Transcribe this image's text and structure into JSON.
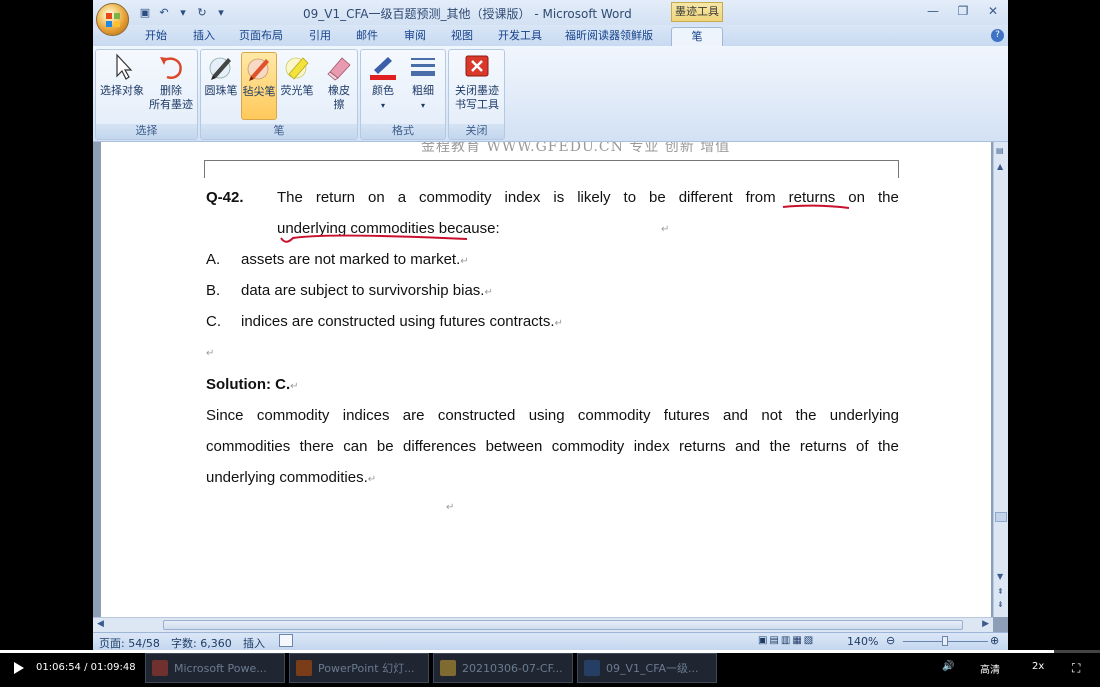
{
  "window": {
    "title": "09_V1_CFA一级百题预测_其他（授课版） - Microsoft Word",
    "context_tab_group": "墨迹工具"
  },
  "tabs": [
    "开始",
    "插入",
    "页面布局",
    "引用",
    "邮件",
    "审阅",
    "视图",
    "开发工具",
    "福昕阅读器领鲜版",
    "笔"
  ],
  "ribbon": {
    "select_group": {
      "label": "选择",
      "select_objects": "选择对象",
      "delete_line1": "删除",
      "delete_line2": "所有墨迹"
    },
    "pen_group": {
      "label": "笔",
      "ballpoint": "圆珠笔",
      "felt_tip": "毡尖笔",
      "highlighter": "荧光笔",
      "eraser_line1": "橡皮",
      "eraser_line2": "擦"
    },
    "format_group": {
      "label": "格式",
      "color": "颜色",
      "weight": "粗细"
    },
    "close_group": {
      "label": "关闭",
      "close_line1": "关闭墨迹",
      "close_line2": "书写工具"
    }
  },
  "document": {
    "header_watermark": "金程教育 WWW.GFEDU.CN 专业 创新 增值",
    "question_number": "Q-42.",
    "question_line1_words": [
      "The",
      "return",
      "on",
      "a",
      "commodity",
      "index",
      "is",
      "likely",
      "to",
      "be",
      "different",
      "from",
      "returns",
      "on",
      "the"
    ],
    "question_line2": "underlying commodities because:",
    "options": [
      {
        "letter": "A.",
        "text": "assets are not marked to market."
      },
      {
        "letter": "B.",
        "text": "data are subject to survivorship bias."
      },
      {
        "letter": "C.",
        "text": "indices are constructed using futures contracts."
      }
    ],
    "solution_head": "Solution: C.",
    "solution_line1_words": [
      "Since",
      "commodity",
      "indices",
      "are",
      "constructed",
      "using",
      "commodity",
      "futures",
      "and",
      "not",
      "the",
      "underlying"
    ],
    "solution_line2_words": [
      "commodities",
      "there",
      "can",
      "be",
      "differences",
      "between",
      "commodity",
      "index",
      "returns",
      "and",
      "the",
      "returns",
      "of",
      "the"
    ],
    "solution_line3": "underlying commodities."
  },
  "statusbar": {
    "page": "页面: 54/58",
    "words": "字数: 6,360",
    "mode": "插入",
    "zoom": "140%"
  },
  "player": {
    "time": "01:06:54 / 01:09:48",
    "quality": "高清",
    "speed": "2x",
    "progress": 0.958
  },
  "taskbar": [
    {
      "label": "Microsoft Powe...",
      "color": "#c0392b"
    },
    {
      "label": "PowerPoint 幻灯...",
      "color": "#d35400"
    },
    {
      "label": "20210306-07-CF...",
      "color": "#e0b030"
    },
    {
      "label": "09_V1_CFA一级...",
      "color": "#2b5797"
    }
  ]
}
